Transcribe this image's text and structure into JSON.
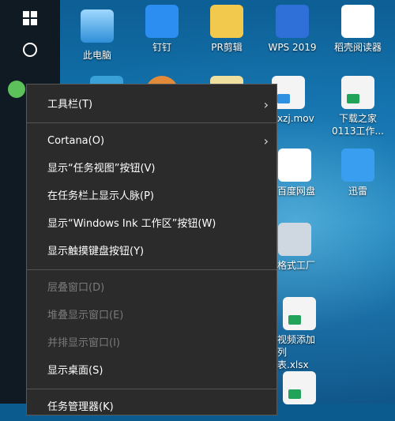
{
  "desktop_icons": [
    {
      "label": "此电脑",
      "icon": "computer-icon"
    },
    {
      "label": "钉钉",
      "icon": "dingtalk-icon"
    },
    {
      "label": "PR剪辑",
      "icon": "pr-folder-icon"
    },
    {
      "label": "WPS 2019",
      "icon": "wps-icon"
    },
    {
      "label": "稻壳阅读器",
      "icon": "daoke-reader-icon"
    },
    {
      "label": "xzj.mov",
      "icon": "video-file-icon"
    },
    {
      "label": "下载之家",
      "icon": "sheet-file-icon"
    },
    {
      "label": "0113工作...",
      "icon": "sheet-file-icon"
    },
    {
      "label": "百度网盘",
      "icon": "baidu-netdisk-icon"
    },
    {
      "label": "迅雷",
      "icon": "xunlei-icon"
    },
    {
      "label": "格式工厂",
      "icon": "format-factory-icon"
    },
    {
      "label": "视频添加列",
      "icon": "sheet-file-icon"
    },
    {
      "label": "表.xlsx",
      "icon": "sheet-file-icon"
    }
  ],
  "menu": {
    "toolbars": "工具栏(T)",
    "cortana": "Cortana(O)",
    "show_task_view": "显示“任务视图”按钮(V)",
    "show_people": "在任务栏上显示人脉(P)",
    "show_windows_ink": "显示“Windows Ink 工作区”按钮(W)",
    "show_touch_keyboard": "显示触摸键盘按钮(Y)",
    "cascade": "层叠窗口(D)",
    "stacked": "堆叠显示窗口(E)",
    "side_by_side": "并排显示窗口(I)",
    "show_desktop": "显示桌面(S)",
    "task_manager": "任务管理器(K)",
    "submenu_arrow": "›"
  }
}
